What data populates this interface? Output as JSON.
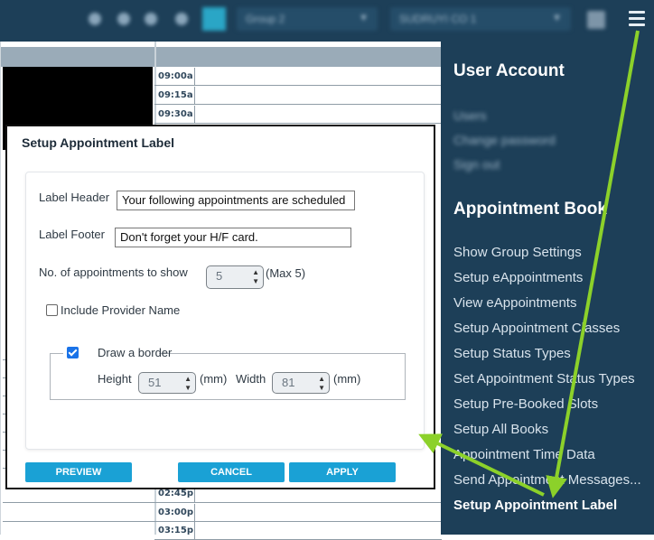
{
  "topbar": {
    "group_select": "Group 2",
    "provider_select": "SUDRUYI CO 1"
  },
  "calendar": {
    "times_top": [
      "09:00a",
      "09:15a",
      "09:30a"
    ],
    "times_bottom": [
      "02:45p",
      "03:00p",
      "03:15p"
    ]
  },
  "sidebar": {
    "user_account_heading": "User Account",
    "blurred_items": [
      "Users",
      "Change password",
      "Sign out"
    ],
    "appointment_book_heading": "Appointment Book",
    "items": [
      "Show Group Settings",
      "Setup eAppointments",
      "View eAppointments",
      "Setup Appointment Classes",
      "Setup Status Types",
      "Set Appointment Status Types",
      "Setup Pre-Booked Slots",
      "Setup All Books",
      "Appointment Time Data",
      "Send Appointment Messages...",
      "Setup Appointment Label"
    ]
  },
  "modal": {
    "title": "Setup Appointment Label",
    "label_header": "Label Header",
    "label_header_value": "Your following appointments are scheduled",
    "label_footer": "Label Footer",
    "label_footer_value": "Don't forget your H/F card.",
    "num_appointments_label": "No. of appointments to show",
    "num_appointments_value": "5",
    "num_appointments_note": "(Max 5)",
    "include_provider_label": "Include Provider Name",
    "include_provider_checked": false,
    "draw_border_label": "Draw a border",
    "draw_border_checked": true,
    "height_label": "Height",
    "height_value": "51",
    "height_unit": "(mm)",
    "width_label": "Width",
    "width_value": "81",
    "width_unit": "(mm)",
    "preview_button": "PREVIEW",
    "cancel_button": "CANCEL",
    "apply_button": "APPLY"
  },
  "colors": {
    "sidebar_bg": "#1d3f58",
    "button_bg": "#1aa1d5",
    "annotation_arrow": "#8cd12a"
  }
}
